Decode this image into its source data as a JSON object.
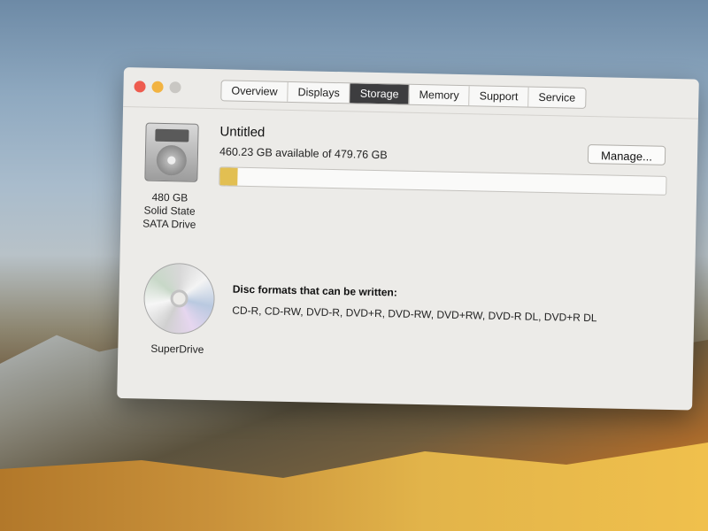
{
  "window": {
    "tabs": [
      {
        "label": "Overview",
        "active": false
      },
      {
        "label": "Displays",
        "active": false
      },
      {
        "label": "Storage",
        "active": true
      },
      {
        "label": "Memory",
        "active": false
      },
      {
        "label": "Support",
        "active": false
      },
      {
        "label": "Service",
        "active": false
      }
    ]
  },
  "storage": {
    "drive": {
      "capacity": "480 GB",
      "type_line1": "Solid State",
      "type_line2": "SATA Drive"
    },
    "volume": {
      "name": "Untitled",
      "availability": "460.23 GB available of 479.76 GB",
      "used_fraction": 0.04,
      "used_color": "#e2bf52"
    },
    "manage_label": "Manage...",
    "optical": {
      "name": "SuperDrive",
      "formats_title": "Disc formats that can be written:",
      "formats": "CD-R, CD-RW, DVD-R, DVD+R, DVD-RW, DVD+RW, DVD-R DL, DVD+R DL"
    }
  },
  "icons": {
    "drive": "hard-drive-icon",
    "disc": "optical-disc-icon"
  }
}
